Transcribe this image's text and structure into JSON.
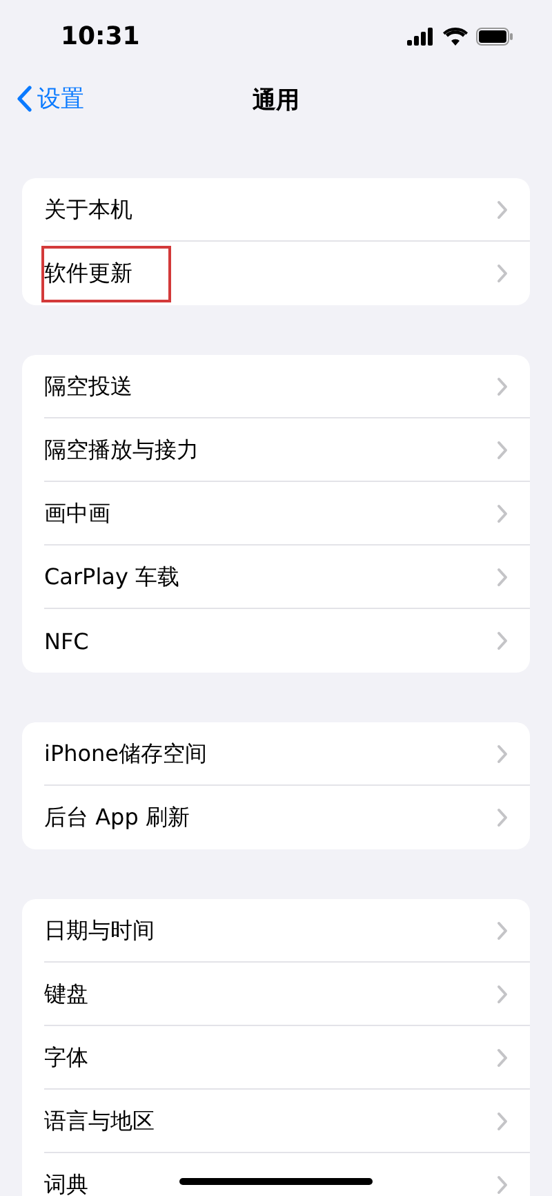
{
  "status_bar": {
    "time": "10:31"
  },
  "nav": {
    "back": "设置",
    "title": "通用"
  },
  "groups": [
    {
      "items": [
        {
          "label": "关于本机",
          "highlighted": false
        },
        {
          "label": "软件更新",
          "highlighted": true
        }
      ]
    },
    {
      "items": [
        {
          "label": "隔空投送",
          "highlighted": false
        },
        {
          "label": "隔空播放与接力",
          "highlighted": false
        },
        {
          "label": "画中画",
          "highlighted": false
        },
        {
          "label": "CarPlay 车载",
          "highlighted": false
        },
        {
          "label": "NFC",
          "highlighted": false
        }
      ]
    },
    {
      "items": [
        {
          "label": "iPhone储存空间",
          "highlighted": false
        },
        {
          "label": "后台 App 刷新",
          "highlighted": false
        }
      ]
    },
    {
      "items": [
        {
          "label": "日期与时间",
          "highlighted": false
        },
        {
          "label": "键盘",
          "highlighted": false
        },
        {
          "label": "字体",
          "highlighted": false
        },
        {
          "label": "语言与地区",
          "highlighted": false
        },
        {
          "label": "词典",
          "highlighted": false
        }
      ]
    }
  ]
}
